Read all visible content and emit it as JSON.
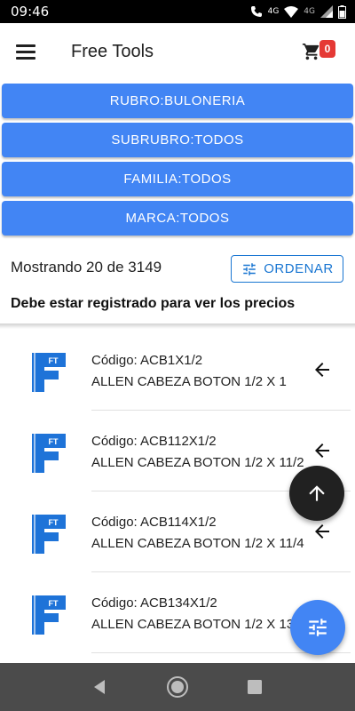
{
  "status_bar": {
    "time": "09:46",
    "network_left": "4G",
    "network_right": "4G"
  },
  "app_bar": {
    "title": "Free Tools",
    "cart_count": "0"
  },
  "filters": [
    {
      "label": "RUBRO:BULONERIA"
    },
    {
      "label": "SUBRUBRO:TODOS"
    },
    {
      "label": "FAMILIA:TODOS"
    },
    {
      "label": "MARCA:TODOS"
    }
  ],
  "results": {
    "showing_text": "Mostrando 20 de 3149",
    "order_label": "ORDENAR"
  },
  "notice": "Debe estar registrado para ver los precios",
  "products": [
    {
      "code": "Código: ACB1X1/2",
      "description": "ALLEN CABEZA BOTON 1/2 X 1",
      "logo_text": "FT"
    },
    {
      "code": "Código: ACB112X1/2",
      "description": "ALLEN CABEZA BOTON 1/2 X 11/2",
      "logo_text": "FT"
    },
    {
      "code": "Código: ACB114X1/2",
      "description": "ALLEN CABEZA BOTON 1/2 X 11/4",
      "logo_text": "FT"
    },
    {
      "code": "Código: ACB134X1/2",
      "description": "ALLEN CABEZA BOTON 1/2 X 13/4",
      "logo_text": "FT"
    }
  ],
  "colors": {
    "primary": "#4285f4",
    "accent_blue": "#1976d2",
    "badge": "#e53935",
    "fab_dark": "#212121",
    "logo_blue": "#1e73d8"
  },
  "icons": {
    "menu": "hamburger-menu-icon",
    "cart": "shopping-cart-icon",
    "order": "tune-icon",
    "row_action": "arrow-left-icon",
    "scroll_top": "arrow-up-icon",
    "filter_fab": "tune-icon",
    "nav": [
      "back-triangle-icon",
      "home-circle-icon",
      "recents-square-icon"
    ]
  }
}
